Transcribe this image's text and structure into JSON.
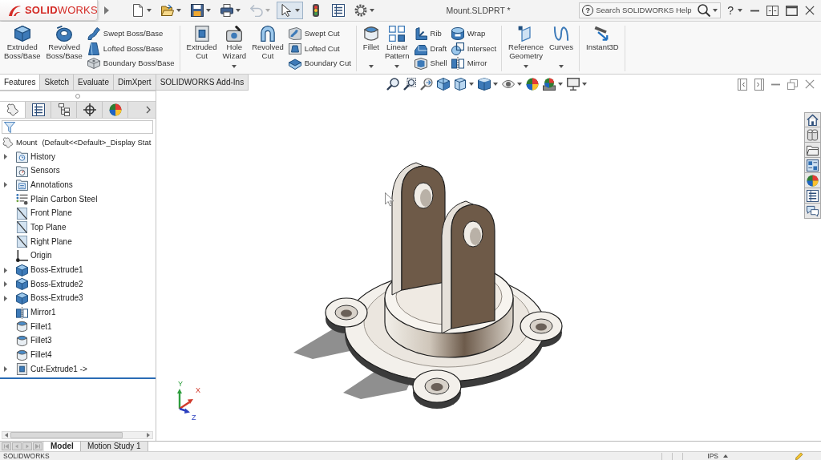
{
  "title_bar": {
    "logo": "**SOLID**WORKS",
    "quick_access": [
      {
        "dropdown": true,
        "disabled": false,
        "selected": false
      },
      {
        "dropdown": true,
        "disabled": false,
        "selected": false
      },
      {
        "dropdown": true,
        "disabled": false,
        "selected": false
      },
      {
        "dropdown": true,
        "disabled": false,
        "selected": false
      },
      {
        "dropdown": true,
        "disabled": true,
        "selected": false
      },
      {
        "dropdown": true,
        "disabled": false,
        "selected": true
      },
      {
        "dropdown": false,
        "disabled": false,
        "selected": false
      },
      {
        "dropdown": false,
        "disabled": false,
        "selected": false
      },
      {
        "dropdown": true,
        "disabled": false,
        "selected": false
      }
    ],
    "document_title": "Mount.SLDPRT *",
    "search": {
      "help_symbol": "?",
      "placeholder": "Search SOLIDWORKS Help"
    },
    "help_button": "?"
  },
  "ribbon": {
    "groups": [
      {
        "buttons": [
          {
            "kind": "large",
            "label": "Extruded Boss/Base",
            "dropdown": false
          },
          {
            "kind": "large",
            "label": "Revolved Boss/Base",
            "dropdown": false
          },
          {
            "kind": "stack",
            "items": [
              {
                "label": "Swept Boss/Base"
              },
              {
                "label": "Lofted Boss/Base"
              },
              {
                "label": "Boundary Boss/Base"
              }
            ]
          }
        ]
      },
      {
        "buttons": [
          {
            "kind": "large",
            "label": "Extruded Cut",
            "dropdown": false
          },
          {
            "kind": "large",
            "label": "Hole Wizard",
            "dropdown": true
          },
          {
            "kind": "large",
            "label": "Revolved Cut",
            "dropdown": false
          },
          {
            "kind": "stack",
            "items": [
              {
                "label": "Swept Cut"
              },
              {
                "label": "Lofted Cut"
              },
              {
                "label": "Boundary Cut"
              }
            ]
          }
        ]
      },
      {
        "buttons": [
          {
            "kind": "large",
            "label": "Fillet",
            "dropdown": true
          },
          {
            "kind": "large",
            "label": "Linear Pattern",
            "dropdown": true
          },
          {
            "kind": "stack",
            "items": [
              {
                "label": "Rib"
              },
              {
                "label": "Draft"
              },
              {
                "label": "Shell"
              }
            ]
          },
          {
            "kind": "stack",
            "items": [
              {
                "label": "Wrap"
              },
              {
                "label": "Intersect"
              },
              {
                "label": "Mirror"
              }
            ]
          }
        ]
      },
      {
        "buttons": [
          {
            "kind": "large",
            "label": "Reference Geometry",
            "dropdown": true
          },
          {
            "kind": "large",
            "label": "Curves",
            "dropdown": true
          }
        ]
      },
      {
        "buttons": [
          {
            "kind": "large",
            "label": "Instant3D",
            "dropdown": false
          }
        ]
      }
    ]
  },
  "command_tabs": [
    {
      "label": "Features",
      "selected": true
    },
    {
      "label": "Sketch",
      "selected": false
    },
    {
      "label": "Evaluate",
      "selected": false
    },
    {
      "label": "DimXpert",
      "selected": false
    },
    {
      "label": "SOLIDWORKS Add-Ins",
      "selected": false
    }
  ],
  "view_toolbar": [
    {
      "dropdown": false
    },
    {
      "dropdown": false
    },
    {
      "dropdown": false
    },
    {
      "dropdown": false
    },
    {
      "dropdown": true
    },
    {
      "dropdown": true
    },
    {
      "dropdown": true
    },
    {
      "dropdown": false
    },
    {
      "dropdown": true
    },
    {
      "dropdown": true
    }
  ],
  "feature_manager": {
    "panel_tabs": [
      {
        "selected": true
      },
      {
        "selected": false
      },
      {
        "selected": false
      },
      {
        "selected": false
      },
      {
        "selected": false
      }
    ],
    "tree": {
      "root": {
        "name": "Mount",
        "configuration": "(Default<<Default>_Display Stat"
      },
      "items": [
        {
          "label": "History",
          "expandable": true
        },
        {
          "label": "Sensors",
          "expandable": false
        },
        {
          "label": "Annotations",
          "expandable": true
        },
        {
          "label": "Plain Carbon Steel",
          "expandable": false
        },
        {
          "label": "Front Plane",
          "expandable": false
        },
        {
          "label": "Top Plane",
          "expandable": false
        },
        {
          "label": "Right Plane",
          "expandable": false
        },
        {
          "label": "Origin",
          "expandable": false
        },
        {
          "label": "Boss-Extrude1",
          "expandable": true
        },
        {
          "label": "Boss-Extrude2",
          "expandable": true
        },
        {
          "label": "Boss-Extrude3",
          "expandable": true
        },
        {
          "label": "Mirror1",
          "expandable": false
        },
        {
          "label": "Fillet1",
          "expandable": false
        },
        {
          "label": "Fillet3",
          "expandable": false
        },
        {
          "label": "Fillet4",
          "expandable": false
        },
        {
          "label": "Cut-Extrude1 ->",
          "expandable": true
        }
      ]
    },
    "bottom_tabs": [
      {
        "label": "Model",
        "selected": true
      },
      {
        "label": "Motion Study 1",
        "selected": false
      }
    ]
  },
  "triad": [
    {
      "label": "Y",
      "color": "#2e9e3e"
    },
    {
      "label": "X",
      "color": "#d0392b"
    },
    {
      "label": "Z",
      "color": "#2b3fbf"
    }
  ],
  "status_bar": {
    "app_name": "SOLIDWORKS",
    "units": "IPS"
  }
}
